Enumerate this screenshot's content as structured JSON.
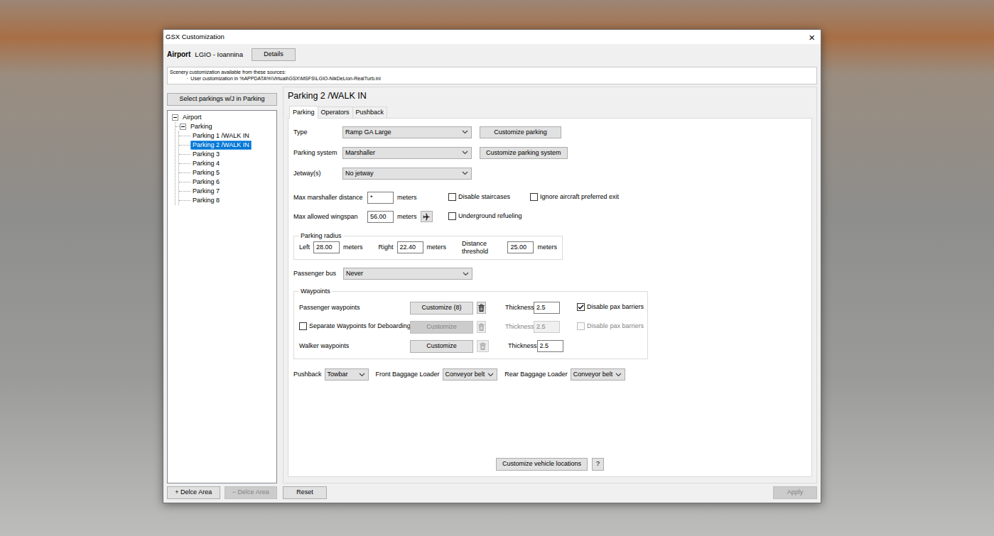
{
  "window": {
    "title": "GSX Customization",
    "close": "×"
  },
  "airport": {
    "label": "Airport",
    "value": "LGIO - Ioannina",
    "details": "Details"
  },
  "sources": {
    "heading": "Scenery customization available from these sources:",
    "items": [
      {
        "bullet": "·",
        "text": "User customization in %APPDATA%\\Virtuali\\GSX\\MSFS\\LGIO-NikDeLion-RealTurb.ini"
      }
    ]
  },
  "sidebar": {
    "select_button": "Select parkings w/J in Parking",
    "tree": [
      {
        "label": "Airport",
        "expanded": true,
        "selected": false,
        "children": [
          {
            "label": "Parking",
            "expanded": true,
            "selected": false,
            "children": [
              {
                "label": "Parking 1 /WALK IN",
                "selected": false
              },
              {
                "label": "Parking 2 /WALK IN",
                "selected": true
              },
              {
                "label": "Parking 3",
                "selected": false
              },
              {
                "label": "Parking 4",
                "selected": false
              },
              {
                "label": "Parking 5",
                "selected": false
              },
              {
                "label": "Parking 6",
                "selected": false
              },
              {
                "label": "Parking 7",
                "selected": false
              },
              {
                "label": "Parking 8",
                "selected": false
              }
            ]
          }
        ]
      }
    ],
    "buttons": [
      {
        "label": "+ Delce Area",
        "disabled": false
      },
      {
        "label": "− Delce Area",
        "disabled": true
      }
    ]
  },
  "panel": {
    "heading": "Parking 2 /WALK IN",
    "tabs": [
      {
        "label": "Parking",
        "selected": true
      },
      {
        "label": "Operators",
        "selected": false
      },
      {
        "label": "Pushback",
        "selected": false
      }
    ]
  },
  "form": {
    "selects": [
      {
        "label": "Type",
        "value": "Ramp GA Large",
        "button": "Customize parking"
      },
      {
        "label": "Parking system",
        "value": "Marshaller",
        "button": "Customize parking system"
      },
      {
        "label": "Jetway(s)",
        "value": "No jetway"
      }
    ],
    "distances": [
      {
        "kind": "input",
        "label": "Max marshaller distance",
        "value": "*",
        "unit": "meters",
        "checkboxes": [
          {
            "label": "Disable staircases",
            "checked": false
          },
          {
            "label": "Ignore aircraft preferred exit",
            "checked": false
          }
        ]
      },
      {
        "kind": "input-button",
        "label": "Max allowed wingspan",
        "value": "56.00",
        "unit": "meters",
        "checkboxes": [
          {
            "label": "Underground refueling",
            "checked": false
          }
        ]
      }
    ],
    "radius": {
      "legend": "Parking radius",
      "fields": [
        {
          "label": "Left",
          "value": "28.00",
          "unit": "meters"
        },
        {
          "label": "Right",
          "value": "22.40",
          "unit": "meters"
        },
        {
          "label": "Distance threshold",
          "value": "25.00",
          "unit": "meters"
        }
      ]
    },
    "passenger_bus": {
      "label": "Passenger bus",
      "value": "Never"
    },
    "waypoints": {
      "legend": "Waypoints",
      "rows": [
        {
          "kind": "label",
          "label": "Passenger waypoints",
          "button": {
            "label": "Customize (8)",
            "disabled": false
          },
          "trash_disabled": false,
          "thickness": {
            "label": "Thickness",
            "value": "2.5",
            "disabled": false
          },
          "barriers": {
            "label": "Disable pax barriers",
            "checked": true,
            "disabled": false
          }
        },
        {
          "kind": "checkbox",
          "label": "Separate Waypoints for Deboarding",
          "checked": false,
          "button": {
            "label": "Customize",
            "disabled": true
          },
          "trash_disabled": true,
          "thickness": {
            "label": "Thickness",
            "value": "2.5",
            "disabled": true
          },
          "barriers": {
            "label": "Disable pax barriers",
            "checked": false,
            "disabled": true
          }
        },
        {
          "kind": "label",
          "label": "Walker waypoints",
          "button": {
            "label": "Customize",
            "disabled": false
          },
          "trash_disabled": true,
          "thickness": {
            "label": "Thickness",
            "value": "2.5",
            "disabled": false
          }
        }
      ]
    },
    "loaders": [
      {
        "label": "Pushback",
        "value": "Towbar"
      },
      {
        "label": "Front Baggage Loader",
        "value": "Conveyor belt"
      },
      {
        "label": "Rear Baggage Loader",
        "value": "Conveyor belt"
      }
    ],
    "vehicle_button": "Customize vehicle locations",
    "help_button": "?"
  },
  "footer": {
    "buttons": [
      {
        "label": "Reset",
        "disabled": false
      },
      {
        "label": "Apply",
        "disabled": true
      }
    ]
  }
}
